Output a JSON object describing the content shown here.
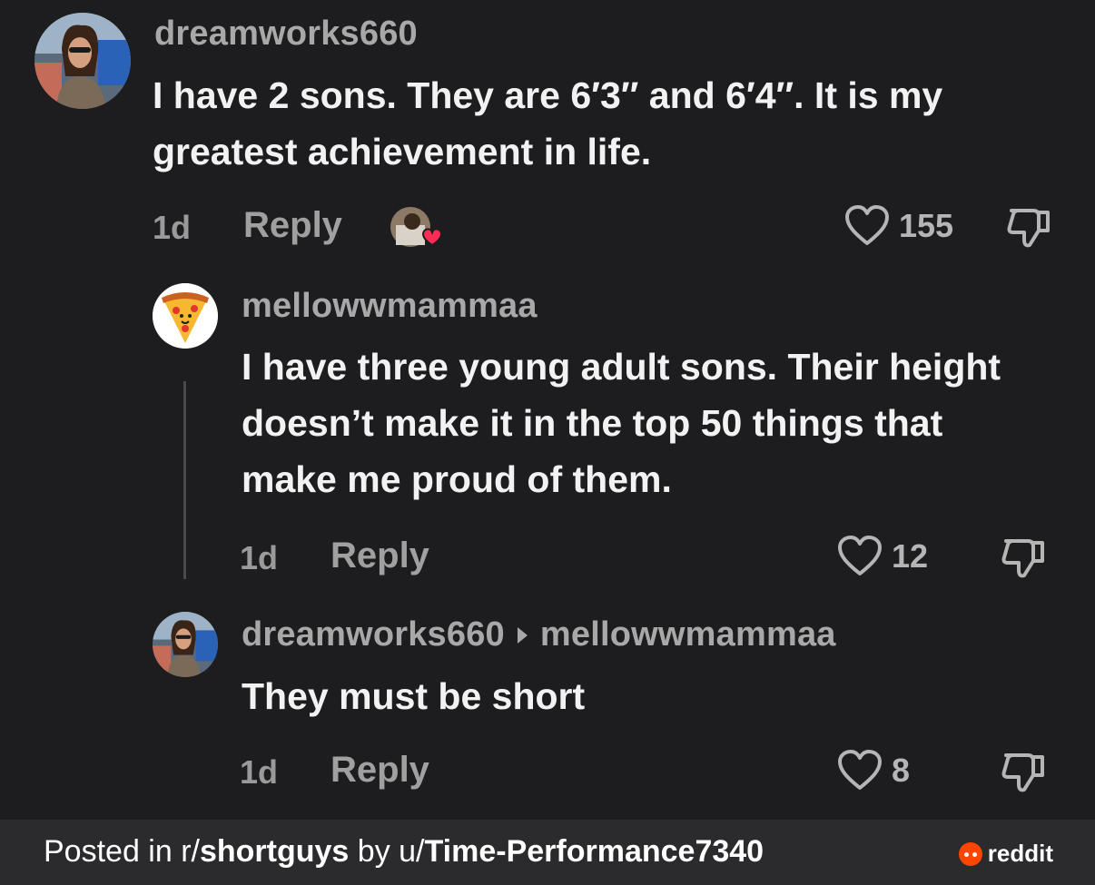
{
  "comments": [
    {
      "username": "dreamworks660",
      "text": "I have 2 sons. They are 6′3″ and 6′4″. It is my greatest achievement in life.",
      "time": "1d",
      "reply_label": "Reply",
      "likes": "155"
    },
    {
      "username": "mellowwmammaa",
      "text": "I have three young adult sons. Their height doesn’t make it in the top 50 things that make me proud of them.",
      "time": "1d",
      "reply_label": "Reply",
      "likes": "12"
    },
    {
      "username": "dreamworks660",
      "reply_to": "mellowwmammaa",
      "text": "They must be short",
      "time": "1d",
      "reply_label": "Reply",
      "likes": "8"
    }
  ],
  "footer": {
    "posted_in": "Posted in r/",
    "subreddit": "shortguys",
    "by": " by u/",
    "author": "Time-Performance7340",
    "brand": "reddit"
  },
  "colors": {
    "background": "#1d1d1f",
    "footer_bg": "#2b2b2d",
    "heart_badge": "#fe2c55",
    "reddit_orange": "#ff4500"
  },
  "icons": [
    "heart-outline-icon",
    "dislike-icon",
    "creator-liked-icon",
    "reddit-logo-icon",
    "pizza-avatar-icon",
    "reply-arrow-icon"
  ]
}
